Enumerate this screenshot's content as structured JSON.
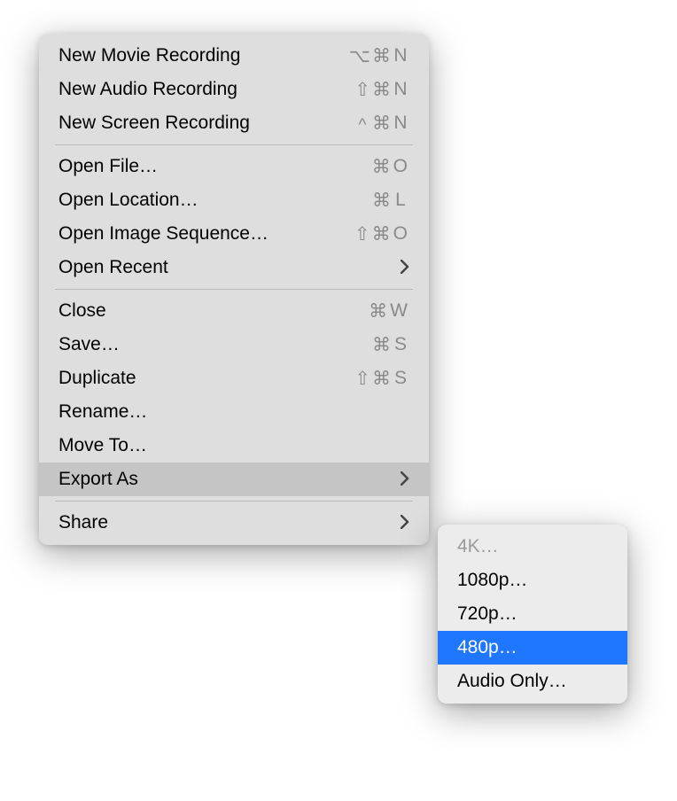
{
  "mainMenu": {
    "items": {
      "newMovieRecording": {
        "label": "New Movie Recording",
        "shortcut_mods": "⌥⌘",
        "shortcut_key": "N"
      },
      "newAudioRecording": {
        "label": "New Audio Recording",
        "shortcut_mods": "⇧⌘",
        "shortcut_key": "N"
      },
      "newScreenRecording": {
        "label": "New Screen Recording",
        "shortcut_mods_ctrl": "^",
        "shortcut_mods": "⌘",
        "shortcut_key": "N"
      },
      "openFile": {
        "label": "Open File…",
        "shortcut_mods": "⌘",
        "shortcut_key": "O"
      },
      "openLocation": {
        "label": "Open Location…",
        "shortcut_mods": "⌘",
        "shortcut_key": "L"
      },
      "openImageSequence": {
        "label": "Open Image Sequence…",
        "shortcut_mods": "⇧⌘",
        "shortcut_key": "O"
      },
      "openRecent": {
        "label": "Open Recent"
      },
      "close": {
        "label": "Close",
        "shortcut_mods": "⌘",
        "shortcut_key": "W"
      },
      "save": {
        "label": "Save…",
        "shortcut_mods": "⌘",
        "shortcut_key": "S"
      },
      "duplicate": {
        "label": "Duplicate",
        "shortcut_mods": "⇧⌘",
        "shortcut_key": "S"
      },
      "rename": {
        "label": "Rename…"
      },
      "moveTo": {
        "label": "Move To…"
      },
      "exportAs": {
        "label": "Export As"
      },
      "share": {
        "label": "Share"
      }
    }
  },
  "exportSubmenu": {
    "items": {
      "fourK": {
        "label": "4K…"
      },
      "p1080": {
        "label": "1080p…"
      },
      "p720": {
        "label": "720p…"
      },
      "p480": {
        "label": "480p…"
      },
      "audioOnly": {
        "label": "Audio Only…"
      }
    }
  }
}
